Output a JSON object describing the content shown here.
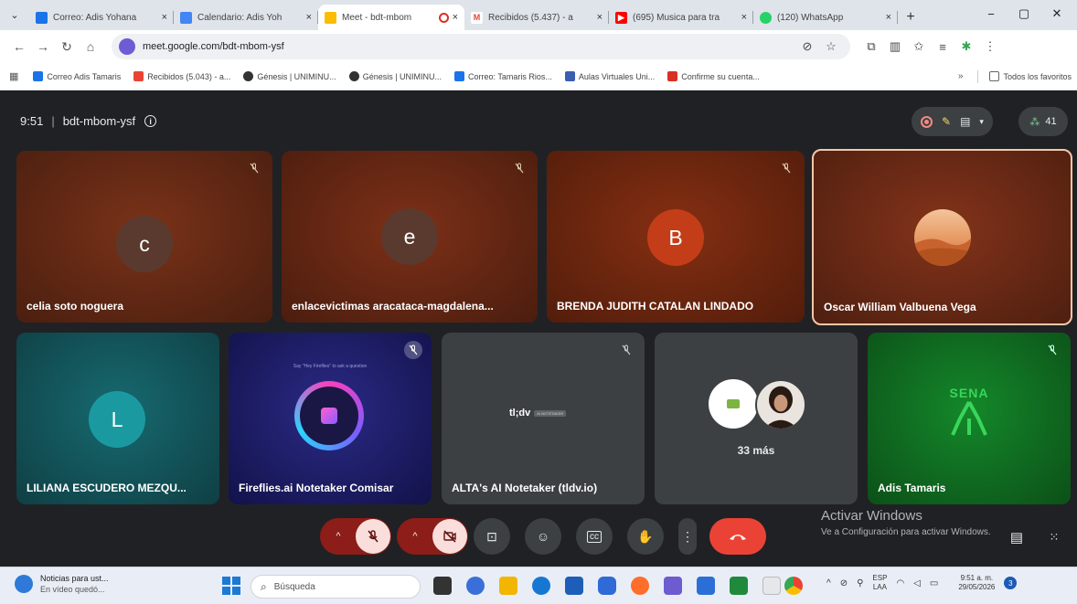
{
  "tabs": [
    {
      "label": "Correo: Adis Yohana",
      "color": "#1a73e8"
    },
    {
      "label": "Calendario: Adis Yoh",
      "color": "#4285f4"
    },
    {
      "label": "Meet - bdt-mbom",
      "color": "#fbbc04"
    },
    {
      "label": "Recibidos (5.437) - a",
      "color": "#ea4335"
    },
    {
      "label": "(695) Musica para tra",
      "color": "#ff0000"
    },
    {
      "label": "(120) WhatsApp",
      "color": "#25d366"
    }
  ],
  "tab_close": "×",
  "new_tab": "+",
  "window_controls": {
    "minimize": "−",
    "maximize": "▢",
    "close": "✕"
  },
  "address": {
    "url": "meet.google.com/bdt-mbom-ysf"
  },
  "bookmarks": [
    {
      "label": "Correo Adis Tamaris",
      "color": "#1a73e8"
    },
    {
      "label": "Recibidos (5.043) - a...",
      "color": "#ea4335"
    },
    {
      "label": "Génesis | UNIMINU...",
      "color": "#333333"
    },
    {
      "label": "Génesis | UNIMINU...",
      "color": "#333333"
    },
    {
      "label": "Correo: Tamaris Rios...",
      "color": "#1a73e8"
    },
    {
      "label": "Aulas Virtuales Uni...",
      "color": "#3b5fb0"
    },
    {
      "label": "Confirme su cuenta...",
      "color": "#d93025"
    }
  ],
  "bookmarks_more": "»",
  "all_bookmarks": "Todos los favoritos",
  "meeting": {
    "time": "9:51",
    "sep": "|",
    "code": "bdt-mbom-ysf",
    "info": "i",
    "participants_count": "41"
  },
  "tiles": [
    {
      "name": "celia soto noguera",
      "initial": "c"
    },
    {
      "name": "enlacevictimas aracataca-magdalena...",
      "initial": "e"
    },
    {
      "name": "BRENDA JUDITH CATALAN LINDADO",
      "initial": "B"
    },
    {
      "name": "Oscar William Valbuena Vega",
      "initial": ""
    },
    {
      "name": "LILIANA ESCUDERO MEZQU...",
      "initial": "L"
    },
    {
      "name": "Fireflies.ai Notetaker Comisar",
      "initial": ""
    },
    {
      "name": "ALTA's AI Notetaker (tldv.io)",
      "initial": ""
    },
    {
      "name": "",
      "initial": ""
    },
    {
      "name": "Adis Tamaris",
      "initial": ""
    }
  ],
  "fireflies_prompt": "Say \"Hey Fireflies\" to ask a question",
  "tldv_logo": "tl;dv",
  "tldv_badge": "AI NOTETAKER",
  "more_count": "33 más",
  "sena_logo": "SENA",
  "activate": {
    "title": "Activar Windows",
    "subtitle": "Ve a Configuración para activar Windows."
  },
  "taskbar": {
    "news_title": "Noticias para ust...",
    "news_sub": "En vídeo quedó...",
    "search_placeholder": "Búsqueda",
    "lang1": "ESP",
    "lang2": "LAA",
    "time": "9:51 a. m.",
    "date": "29/05/2026",
    "notification_count": "3"
  }
}
